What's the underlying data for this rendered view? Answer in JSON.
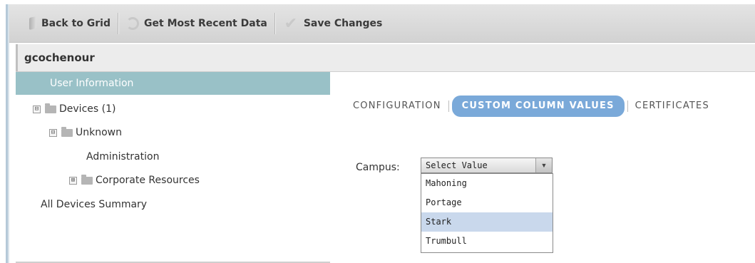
{
  "toolbar": {
    "back_label": "Back to Grid",
    "refresh_label": "Get Most Recent Data",
    "save_label": "Save Changes"
  },
  "window": {
    "title": "gcochenour"
  },
  "sidebar": {
    "items": [
      {
        "label": "User Information",
        "selected": true
      },
      {
        "label": "Devices (1)",
        "expander": "⊟"
      },
      {
        "label": "Unknown",
        "expander": "⊟"
      },
      {
        "label": "Administration"
      },
      {
        "label": "Corporate Resources",
        "expander": "⊞"
      },
      {
        "label": "All Devices Summary"
      }
    ]
  },
  "tabs": [
    {
      "label": "CONFIGURATION",
      "active": false
    },
    {
      "label": "CUSTOM COLUMN VALUES",
      "active": true
    },
    {
      "label": "CERTIFICATES",
      "active": false
    }
  ],
  "form": {
    "campus_label": "Campus:",
    "select_value": "Select Value",
    "options": [
      "Mahoning",
      "Portage",
      "Stark",
      "Trumbull"
    ],
    "highlighted_option": "Stark"
  },
  "colors": {
    "selected_item": "#99c1c7",
    "active_tab": "#7aa9d9",
    "highlight_option": "#c9d8ec"
  }
}
